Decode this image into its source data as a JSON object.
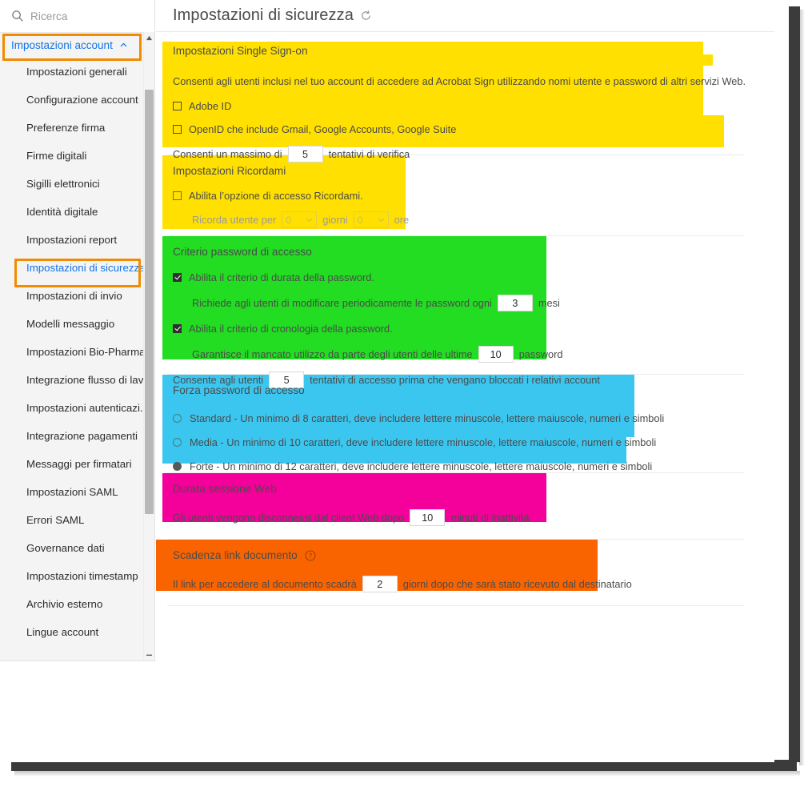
{
  "window": {
    "title": "Impostazioni di sicurezza"
  },
  "sidebar": {
    "search": {
      "placeholder": "Ricerca",
      "icon": "search-icon"
    },
    "group": {
      "label": "Impostazioni account",
      "icon": "chevron-up-icon",
      "expanded": true
    },
    "items": [
      {
        "label": "Impostazioni generali",
        "selected": false
      },
      {
        "label": "Configurazione account",
        "selected": false
      },
      {
        "label": "Preferenze firma",
        "selected": false
      },
      {
        "label": "Firme digitali",
        "selected": false
      },
      {
        "label": "Sigilli elettronici",
        "selected": false
      },
      {
        "label": "Identità digitale",
        "selected": false
      },
      {
        "label": "Impostazioni report",
        "selected": false
      },
      {
        "label": "Impostazioni di sicurezza",
        "selected": true
      },
      {
        "label": "Impostazioni di invio",
        "selected": false
      },
      {
        "label": "Modelli messaggio",
        "selected": false
      },
      {
        "label": "Impostazioni Bio-Pharma",
        "selected": false
      },
      {
        "label": "Integrazione flusso di lav...",
        "selected": false
      },
      {
        "label": "Impostazioni autenticazi...",
        "selected": false
      },
      {
        "label": "Integrazione pagamenti",
        "selected": false
      },
      {
        "label": "Messaggi per firmatari",
        "selected": false
      },
      {
        "label": "Impostazioni SAML",
        "selected": false
      },
      {
        "label": "Errori SAML",
        "selected": false
      },
      {
        "label": "Governance dati",
        "selected": false
      },
      {
        "label": "Impostazioni timestamp",
        "selected": false
      },
      {
        "label": "Archivio esterno",
        "selected": false
      },
      {
        "label": "Lingue account",
        "selected": false
      }
    ]
  },
  "header": {
    "title": "Impostazioni di sicurezza",
    "refresh_icon": "refresh-icon"
  },
  "highlight_colors": {
    "selection_box": "#F28B00",
    "single_sign_on": "#FFE000",
    "remember_me": "#FFE000",
    "password_policy": "#22DD22",
    "password_strength": "#3BC6F0",
    "web_session": "#F4009B",
    "document_link": "#FA6400"
  },
  "sections": {
    "sso": {
      "title": "Impostazioni Single Sign-on",
      "description": "Consenti agli utenti inclusi nel tuo account di accedere ad Acrobat Sign utilizzando nomi utente e password di altri servizi Web.",
      "checkboxes": [
        {
          "label": "Adobe ID",
          "checked": false
        },
        {
          "label": "OpenID che include Gmail, Google Accounts, Google Suite",
          "checked": false
        }
      ],
      "attempts_prefix": "Consenti un massimo di",
      "attempts_value": "5",
      "attempts_suffix": "tentativi di verifica"
    },
    "remember": {
      "title": "Impostazioni Ricordami",
      "enable_label": "Abilita l’opzione di accesso Ricordami.",
      "enable_checked": false,
      "duration_prefix": "Ricorda utente per",
      "days_value": "0",
      "days_label": "giorni",
      "hours_value": "0",
      "hours_label": "ore"
    },
    "password_policy": {
      "title": "Criterio password di accesso",
      "duration_label": "Abilita il criterio di durata della password.",
      "duration_checked": true,
      "change_prefix": "Richiede agli utenti di modificare periodicamente le password ogni",
      "change_value": "3",
      "change_suffix": "mesi",
      "history_label": "Abilita il criterio di cronologia della password.",
      "history_checked": true,
      "history_prefix": "Garantisce il mancato utilizzo da parte degli utenti delle ultime",
      "history_value": "10",
      "history_suffix": "password",
      "attempts_prefix": "Consente agli utenti",
      "attempts_value": "5",
      "attempts_suffix": "tentativi di accesso prima che vengano bloccati i relativi account"
    },
    "password_strength": {
      "title": "Forza password di accesso",
      "options": [
        {
          "label": "Standard - Un minimo di 8 caratteri, deve includere lettere minuscole, lettere maiuscole, numeri e simboli",
          "selected": false
        },
        {
          "label": "Media - Un minimo di 10 caratteri, deve includere lettere minuscole, lettere maiuscole, numeri e simboli",
          "selected": false
        },
        {
          "label": "Forte - Un minimo di 12 caratteri, deve includere lettere minuscole, lettere maiuscole, numeri e simboli",
          "selected": true
        }
      ]
    },
    "web_session": {
      "title": "Durata sessione Web",
      "prefix": "Gli utenti vengono disconnessi dal client Web dopo",
      "value": "10",
      "suffix": "minuti di inattività"
    },
    "document_link": {
      "title": "Scadenza link documento",
      "help_icon": "help-circle-icon",
      "prefix": "Il link per accedere al documento scadrà",
      "value": "2",
      "suffix": "giorni dopo che sarà stato ricevuto dal destinatario"
    }
  }
}
